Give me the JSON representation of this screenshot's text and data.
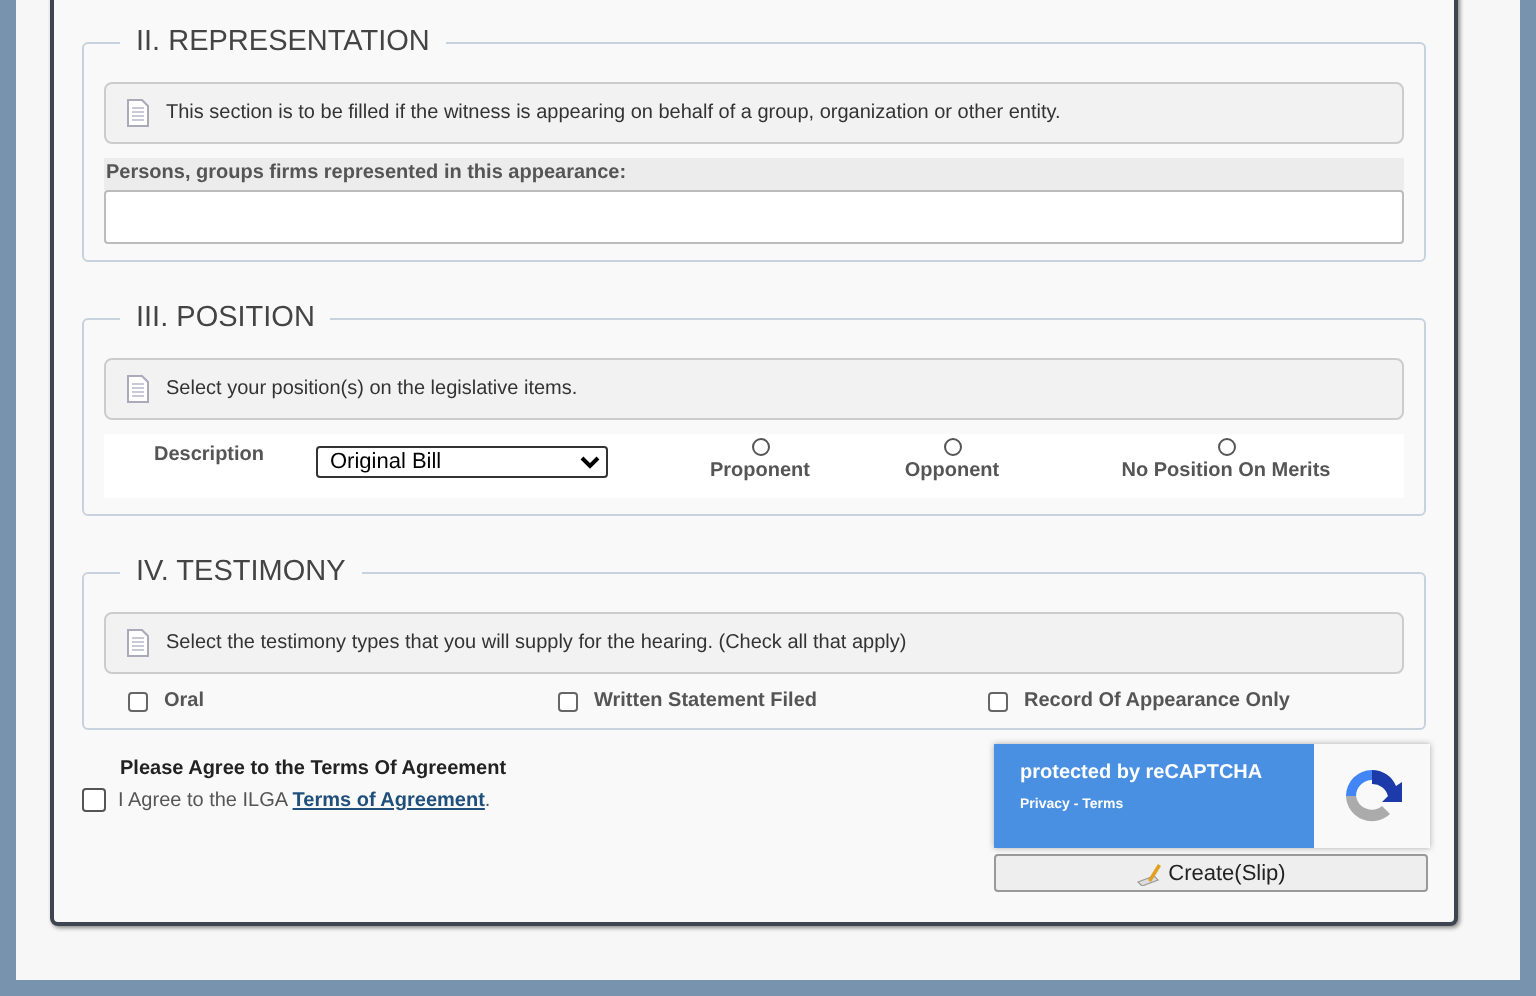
{
  "representation": {
    "legend": "II. REPRESENTATION",
    "note": "This section is to be filled if the witness is appearing on behalf of a group, organization or other entity.",
    "field_label": "Persons, groups firms represented in this appearance:"
  },
  "position": {
    "legend": "III. POSITION",
    "note": "Select your position(s) on the legislative items.",
    "description_label": "Description",
    "select_value": "Original Bill",
    "options": [
      {
        "label": "Proponent",
        "selected": false
      },
      {
        "label": "Opponent",
        "selected": false
      },
      {
        "label": "No Position On Merits",
        "selected": false
      }
    ]
  },
  "testimony": {
    "legend": "IV. TESTIMONY",
    "note": "Select the testimony types that you will supply for the hearing. (Check all that apply)",
    "types": [
      {
        "label": "Oral",
        "checked": false
      },
      {
        "label": "Written Statement Filed",
        "checked": false
      },
      {
        "label": "Record Of Appearance Only",
        "checked": false
      }
    ]
  },
  "agreement": {
    "heading": "Please Agree to the Terms Of Agreement",
    "checked": false,
    "prefix": "I Agree to the ILGA ",
    "link": "Terms of Agreement",
    "suffix": "."
  },
  "recaptcha": {
    "title": "protected by reCAPTCHA",
    "privacy": "Privacy",
    "separator": " - ",
    "terms": "Terms"
  },
  "submit": {
    "label": "Create(Slip)"
  }
}
